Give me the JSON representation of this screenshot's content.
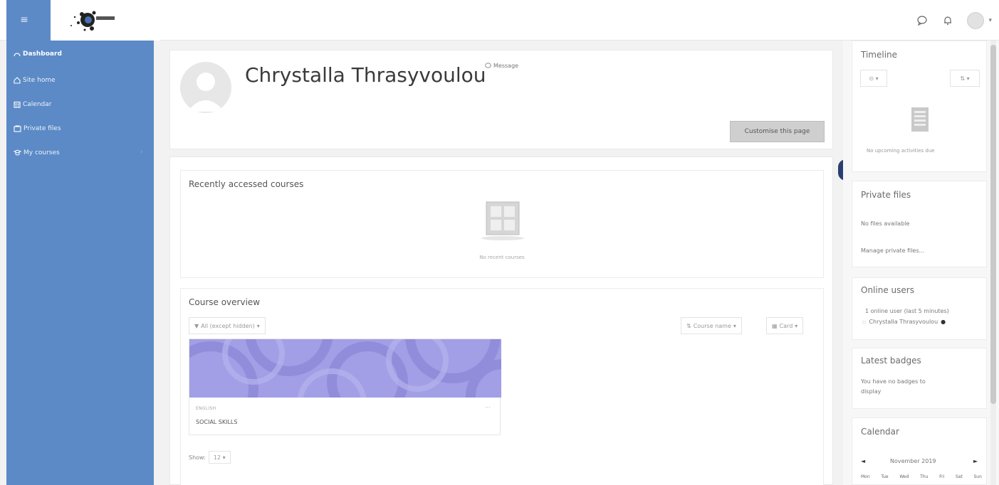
{
  "sidebar": {
    "items": [
      {
        "label": "Dashboard",
        "icon": "dashboard-icon"
      },
      {
        "label": "Site home",
        "icon": "home-icon"
      },
      {
        "label": "Calendar",
        "icon": "calendar-icon"
      },
      {
        "label": "Private files",
        "icon": "file-icon"
      },
      {
        "label": "My courses",
        "icon": "courses-icon"
      }
    ]
  },
  "colors": {
    "accent": "#5b8ac6",
    "drawer": "#2c3e70",
    "course_pattern": "#a29fe6"
  },
  "profile": {
    "name": "Chrystalla Thrasyvoulou",
    "message_label": "Message",
    "customise_label": "Customise this page"
  },
  "recent": {
    "title": "Recently accessed courses",
    "empty": "No recent courses"
  },
  "overview": {
    "title": "Course overview",
    "filter_label": "All (except hidden)",
    "sort_label": "Course name",
    "view_label": "Card",
    "course": {
      "category": "ENGLISH",
      "name": "SOCIAL SKILLS"
    },
    "show_label": "Show:",
    "show_value": "12"
  },
  "right": {
    "timeline": {
      "title": "Timeline",
      "empty": "No upcoming activities due"
    },
    "private_files": {
      "title": "Private files",
      "empty": "No files available",
      "manage": "Manage private files..."
    },
    "online": {
      "title": "Online users",
      "summary": "1 online user (last 5 minutes)",
      "user": "Chrystalla Thrasyvoulou"
    },
    "badges": {
      "title": "Latest badges",
      "line1": "You have no badges to",
      "line2": "display"
    },
    "calendar": {
      "title": "Calendar",
      "month": "November 2019",
      "days": [
        "Mon",
        "Tue",
        "Wed",
        "Thu",
        "Fri",
        "Sat",
        "Sun"
      ]
    }
  }
}
